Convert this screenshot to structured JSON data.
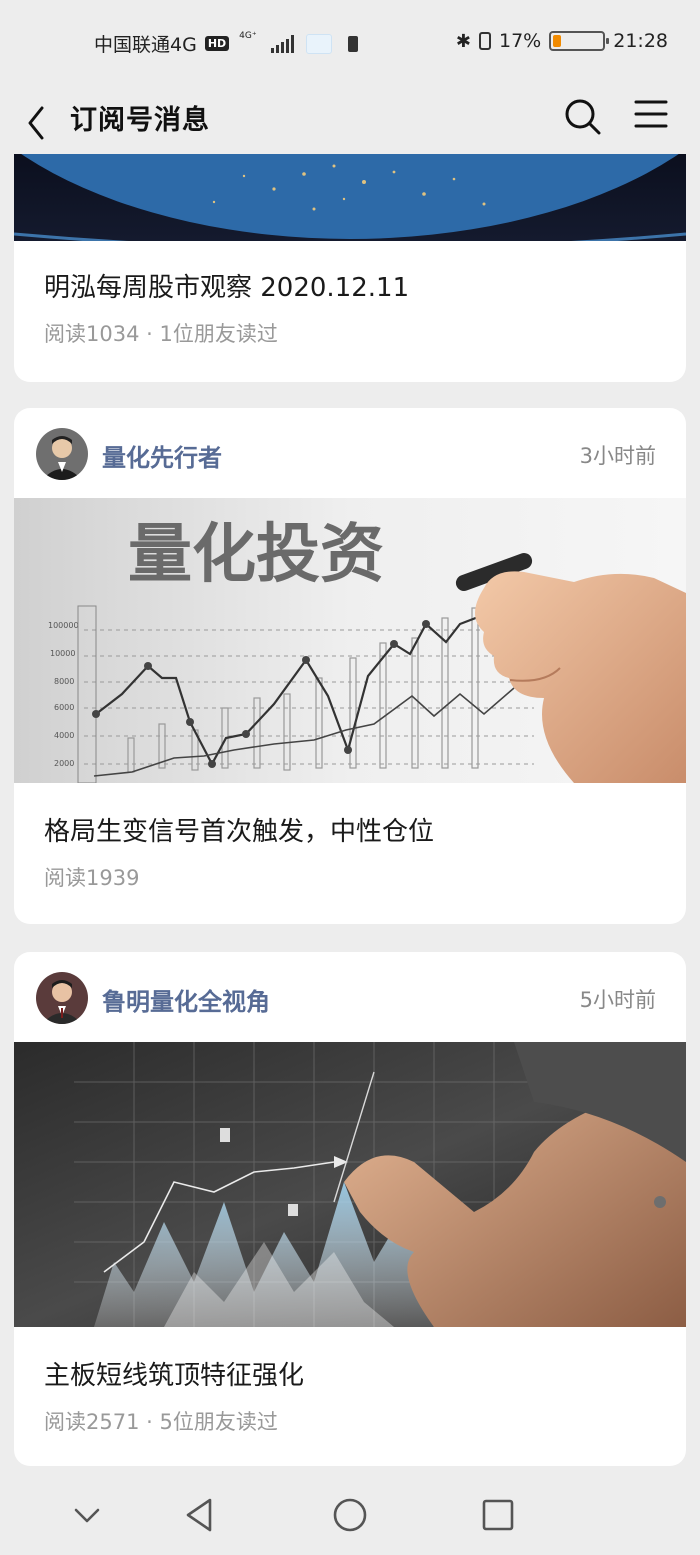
{
  "status_bar": {
    "carrier": "中国联通4G",
    "hd_badge": "HD",
    "network_type": "4G⁺",
    "battery_percent": "17%",
    "time": "21:28",
    "battery_level": 0.17,
    "battery_color": "#f08a00"
  },
  "nav": {
    "title": "订阅号消息",
    "back_icon": "chevron-left-icon",
    "search_icon": "search-icon",
    "menu_icon": "menu-icon"
  },
  "articles": [
    {
      "title": "明泓每周股市观察 2020.12.11",
      "meta": "阅读1034 · 1位朋友读过"
    },
    {
      "author": "量化先行者",
      "time": "3小时前",
      "cover_text": "量化投资",
      "cover_ticks": [
        "100000",
        "10000",
        "8000",
        "6000",
        "4000",
        "2000"
      ],
      "title": "格局生变信号首次触发，中性仓位",
      "meta": "阅读1939"
    },
    {
      "author": "鲁明量化全视角",
      "time": "5小时前",
      "title": "主板短线筑顶特征强化",
      "meta": "阅读2571 · 5位朋友读过"
    }
  ],
  "bottom_nav": {
    "items": [
      "chevron-down-icon",
      "back-triangle-icon",
      "home-circle-icon",
      "recents-square-icon"
    ]
  },
  "colors": {
    "author_link": "#576b95",
    "page_bg": "#ededed",
    "meta_text": "#999999"
  }
}
